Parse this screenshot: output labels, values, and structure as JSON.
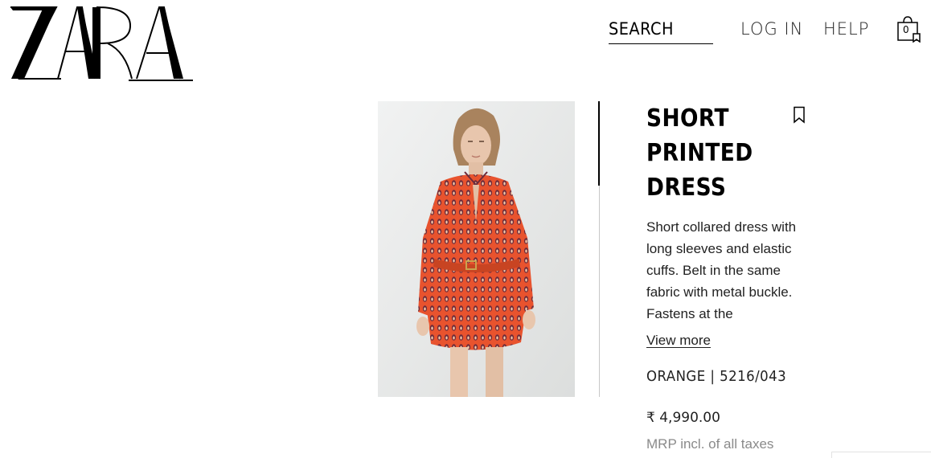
{
  "header": {
    "logo_text": "ZARA",
    "search_label": "SEARCH",
    "login_label": "LOG IN",
    "help_label": "HELP",
    "cart_count": "0",
    "cart_icon": "shopping-bag-icon"
  },
  "product": {
    "title_lines": [
      "SHORT",
      "PRINTED",
      "DRESS"
    ],
    "description": "Short collared dress with long sleeves and elastic cuffs. Belt in the same fabric with metal buckle. Fastens at the",
    "view_more_label": "View more",
    "color_ref": "ORANGE | 5216/043",
    "price": "₹ 4,990.00",
    "tax_note": "MRP incl. of all taxes",
    "bookmark_icon": "bookmark-icon",
    "image_icon": "product-photo"
  },
  "colors": {
    "dress_orange": "#e8532e",
    "dress_pattern": "#6b2a3a",
    "background_grey": "#e9eaea"
  }
}
